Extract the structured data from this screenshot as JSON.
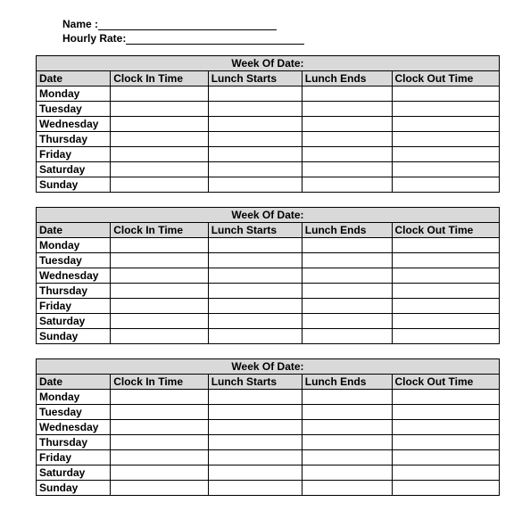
{
  "header": {
    "name_label": "Name :",
    "rate_label": "Hourly Rate:"
  },
  "columns": {
    "date": "Date",
    "clock_in": "Clock In Time",
    "lunch_start": "Lunch Starts",
    "lunch_end": "Lunch Ends",
    "clock_out": "Clock Out Time"
  },
  "week_title": "Week Of Date:",
  "days": [
    "Monday",
    "Tuesday",
    "Wednesday",
    "Thursday",
    "Friday",
    "Saturday",
    "Sunday"
  ],
  "weeks": [
    {
      "rows": [
        {
          "date": "Monday",
          "ci": "",
          "ls": "",
          "le": "",
          "co": ""
        },
        {
          "date": "Tuesday",
          "ci": "",
          "ls": "",
          "le": "",
          "co": ""
        },
        {
          "date": "Wednesday",
          "ci": "",
          "ls": "",
          "le": "",
          "co": ""
        },
        {
          "date": "Thursday",
          "ci": "",
          "ls": "",
          "le": "",
          "co": ""
        },
        {
          "date": "Friday",
          "ci": "",
          "ls": "",
          "le": "",
          "co": ""
        },
        {
          "date": "Saturday",
          "ci": "",
          "ls": "",
          "le": "",
          "co": ""
        },
        {
          "date": "Sunday",
          "ci": "",
          "ls": "",
          "le": "",
          "co": ""
        }
      ]
    },
    {
      "rows": [
        {
          "date": "Monday",
          "ci": "",
          "ls": "",
          "le": "",
          "co": ""
        },
        {
          "date": "Tuesday",
          "ci": "",
          "ls": "",
          "le": "",
          "co": ""
        },
        {
          "date": "Wednesday",
          "ci": "",
          "ls": "",
          "le": "",
          "co": ""
        },
        {
          "date": "Thursday",
          "ci": "",
          "ls": "",
          "le": "",
          "co": ""
        },
        {
          "date": "Friday",
          "ci": "",
          "ls": "",
          "le": "",
          "co": ""
        },
        {
          "date": "Saturday",
          "ci": "",
          "ls": "",
          "le": "",
          "co": ""
        },
        {
          "date": "Sunday",
          "ci": "",
          "ls": "",
          "le": "",
          "co": ""
        }
      ]
    },
    {
      "rows": [
        {
          "date": "Monday",
          "ci": "",
          "ls": "",
          "le": "",
          "co": ""
        },
        {
          "date": "Tuesday",
          "ci": "",
          "ls": "",
          "le": "",
          "co": ""
        },
        {
          "date": "Wednesday",
          "ci": "",
          "ls": "",
          "le": "",
          "co": ""
        },
        {
          "date": "Thursday",
          "ci": "",
          "ls": "",
          "le": "",
          "co": ""
        },
        {
          "date": "Friday",
          "ci": "",
          "ls": "",
          "le": "",
          "co": ""
        },
        {
          "date": "Saturday",
          "ci": "",
          "ls": "",
          "le": "",
          "co": ""
        },
        {
          "date": "Sunday",
          "ci": "",
          "ls": "",
          "le": "",
          "co": ""
        }
      ]
    }
  ]
}
